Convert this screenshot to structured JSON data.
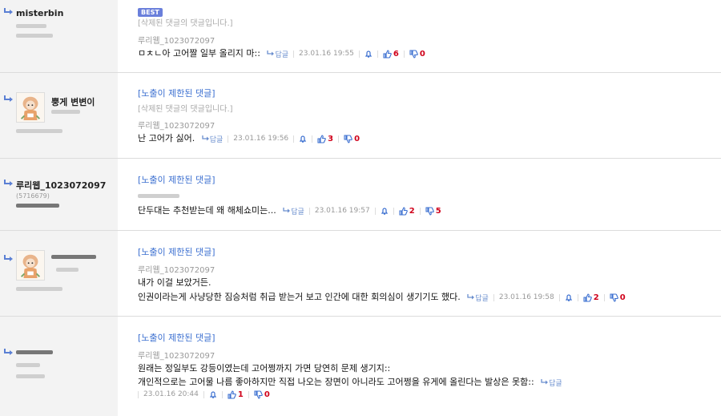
{
  "comments": [
    {
      "nickname": "misterbin",
      "best_badge": "BEST",
      "deleted_note": "[삭제된 댓글의 댓글입니다.]",
      "author": "루리웹_1023072097",
      "lines": [
        "ㅁㅊㄴ아 고어짤 일부 올리지 마::"
      ],
      "reply_label": "답글",
      "date": "23.01.16 19:55",
      "up": "6",
      "down": "0"
    },
    {
      "nickname": "뿡게 변변이",
      "restricted": "[노출이 제한된 댓글]",
      "deleted_note": "[삭제된 댓글의 댓글입니다.]",
      "author": "루리웹_1023072097",
      "lines": [
        "난 고어가 싫어."
      ],
      "reply_label": "답글",
      "date": "23.01.16 19:56",
      "up": "3",
      "down": "0"
    },
    {
      "nickname": "루리웹_1023072097",
      "user_id": "(5716679)",
      "restricted": "[노출이 제한된 댓글]",
      "lines": [
        "단두대는 추천받는데 왜 해체쇼미는..."
      ],
      "reply_label": "답글",
      "date": "23.01.16 19:57",
      "up": "2",
      "down": "5"
    },
    {
      "restricted": "[노출이 제한된 댓글]",
      "author": "루리웹_1023072097",
      "lines": [
        "내가 이걸 보았거든.",
        "인권이라는게 사냥당한 짐승처럼 취급 받는거 보고 인간에 대한 회의심이 생기기도 했다."
      ],
      "reply_label": "답글",
      "date": "23.01.16 19:58",
      "up": "2",
      "down": "0"
    },
    {
      "restricted": "[노출이 제한된 댓글]",
      "author": "루리웹_1023072097",
      "lines": [
        "원래는 정일부도 강등이였는데 고어쩡까지 가면 당연히 문제 생기지::",
        "개인적으로는 고어물 나름 좋아하지만 직접 나오는 장면이 아니라도 고어쩡을 유게에 올린다는 발상은 못함::"
      ],
      "reply_label": "답글",
      "date": "23.01.16 20:44",
      "up": "1",
      "down": "0"
    }
  ]
}
